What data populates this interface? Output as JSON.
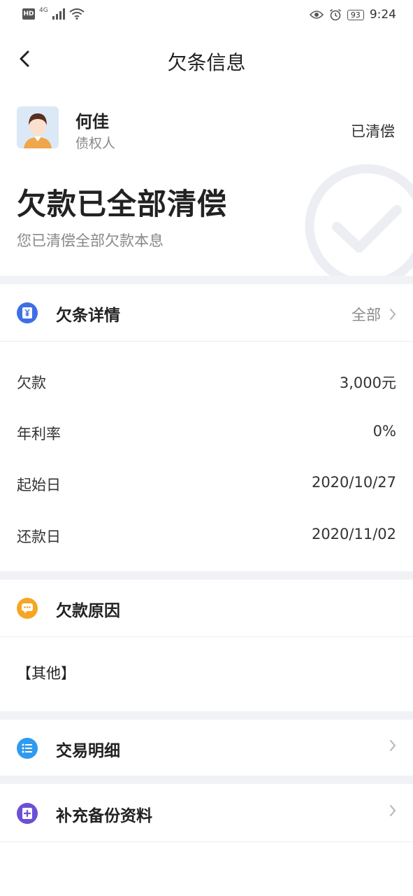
{
  "status_bar": {
    "hd": "HD",
    "network": "4G",
    "battery": "93",
    "time": "9:24"
  },
  "nav": {
    "title": "欠条信息"
  },
  "header": {
    "creditor_name": "何佳",
    "creditor_role": "债权人",
    "status": "已清偿",
    "title": "欠款已全部清偿",
    "subtitle": "您已清偿全部欠款本息"
  },
  "details": {
    "title": "欠条详情",
    "link_label": "全部",
    "rows": [
      {
        "label": "欠款",
        "value": "3,000元"
      },
      {
        "label": "年利率",
        "value": "0%"
      },
      {
        "label": "起始日",
        "value": "2020/10/27"
      },
      {
        "label": "还款日",
        "value": "2020/11/02"
      }
    ]
  },
  "reason": {
    "title": "欠款原因",
    "text": "【其他】"
  },
  "transactions": {
    "title": "交易明细"
  },
  "backup": {
    "title": "补充备份资料"
  },
  "colors": {
    "detail_icon": "#3f6fe6",
    "reason_icon": "#f5a623",
    "transactions_icon": "#2e9bf0",
    "backup_icon": "#6b4fd6",
    "divider": "#f1f2f5"
  }
}
